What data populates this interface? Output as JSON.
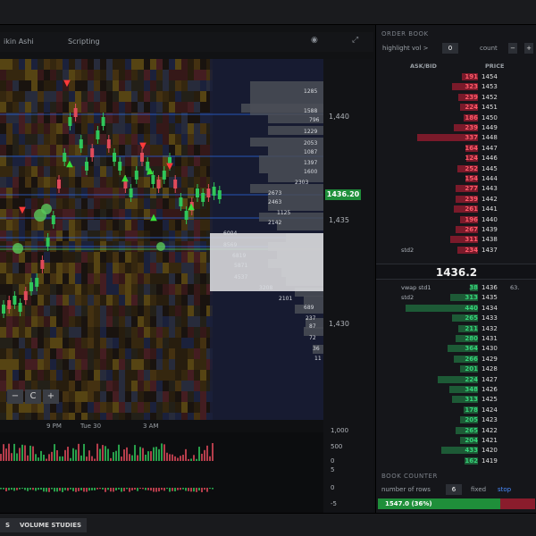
{
  "chart_header": {
    "tabs": [
      "ikin Ashi",
      "Scripting"
    ],
    "icons": [
      "camera-icon",
      "expand-icon"
    ]
  },
  "price_axis": {
    "ticks": [
      "1,440",
      "1,435",
      "1,430"
    ],
    "current_price": "1436.20"
  },
  "volume_labels": [
    {
      "text": "1285"
    },
    {
      "text": "1588"
    },
    {
      "text": "796"
    },
    {
      "text": "1229"
    },
    {
      "text": "2053"
    },
    {
      "text": "1087"
    },
    {
      "text": "1397"
    },
    {
      "text": "1600"
    },
    {
      "text": "2303"
    },
    {
      "text": "2673"
    },
    {
      "text": "2463"
    },
    {
      "text": "1125"
    },
    {
      "text": "2142"
    },
    {
      "text": "6004"
    },
    {
      "text": "8569"
    },
    {
      "text": "6819"
    },
    {
      "text": "5871"
    },
    {
      "text": "4537"
    },
    {
      "text": "3208"
    },
    {
      "text": "2101"
    },
    {
      "text": "689"
    },
    {
      "text": "237"
    },
    {
      "text": "87"
    },
    {
      "text": "72"
    },
    {
      "text": "36"
    },
    {
      "text": "11"
    }
  ],
  "zoom_controls": {
    "minus": "−",
    "reset": "C",
    "plus": "+"
  },
  "time_axis": [
    "9 PM",
    "Tue 30",
    "3 AM"
  ],
  "lower_axis": [
    "1,000",
    "500",
    "0",
    "5",
    "0",
    "-5"
  ],
  "bottom_bar": {
    "buttons": [
      "S",
      "VOLUME STUDIES"
    ]
  },
  "order_book": {
    "title": "ORDER BOOK",
    "highlight_label": "highlight vol >",
    "highlight_value": "0",
    "count_label": "count",
    "controls": [
      "−",
      "+"
    ],
    "columns": {
      "ask_bid": "ASK/BID",
      "price": "PRICE"
    },
    "asks": [
      {
        "qty": "191",
        "price": "1454",
        "w": 0.2
      },
      {
        "qty": "323",
        "price": "1453",
        "w": 0.32
      },
      {
        "qty": "239",
        "price": "1452",
        "w": 0.24
      },
      {
        "qty": "224",
        "price": "1451",
        "w": 0.22
      },
      {
        "qty": "186",
        "price": "1450",
        "w": 0.18
      },
      {
        "qty": "239",
        "price": "1449",
        "w": 0.3
      },
      {
        "qty": "337",
        "price": "1448",
        "w": 0.75
      },
      {
        "qty": "164",
        "price": "1447",
        "w": 0.16
      },
      {
        "qty": "124",
        "price": "1446",
        "w": 0.14
      },
      {
        "qty": "252",
        "price": "1445",
        "w": 0.26
      },
      {
        "qty": "154",
        "price": "1444",
        "w": 0.16
      },
      {
        "qty": "277",
        "price": "1443",
        "w": 0.28
      },
      {
        "qty": "239",
        "price": "1442",
        "w": 0.28
      },
      {
        "qty": "261",
        "price": "1441",
        "w": 0.3
      },
      {
        "qty": "196",
        "price": "1440",
        "w": 0.22
      },
      {
        "qty": "267",
        "price": "1439",
        "w": 0.28
      },
      {
        "qty": "311",
        "price": "1438",
        "w": 0.34
      },
      {
        "qty": "234",
        "price": "1437",
        "w": 0.26
      }
    ],
    "ask_labels": {
      "row17": "std2"
    },
    "mid_price": "1436.2",
    "bids": [
      {
        "qty": "38",
        "price": "1436",
        "w": 0.1
      },
      {
        "qty": "313",
        "price": "1435",
        "w": 0.34
      },
      {
        "qty": "440",
        "price": "1434",
        "w": 0.9
      },
      {
        "qty": "265",
        "price": "1433",
        "w": 0.32
      },
      {
        "qty": "211",
        "price": "1432",
        "w": 0.24
      },
      {
        "qty": "280",
        "price": "1431",
        "w": 0.28
      },
      {
        "qty": "364",
        "price": "1430",
        "w": 0.38
      },
      {
        "qty": "266",
        "price": "1429",
        "w": 0.3
      },
      {
        "qty": "201",
        "price": "1428",
        "w": 0.22
      },
      {
        "qty": "224",
        "price": "1427",
        "w": 0.5
      },
      {
        "qty": "348",
        "price": "1426",
        "w": 0.36
      },
      {
        "qty": "313",
        "price": "1425",
        "w": 0.32
      },
      {
        "qty": "178",
        "price": "1424",
        "w": 0.18
      },
      {
        "qty": "205",
        "price": "1423",
        "w": 0.22
      },
      {
        "qty": "265",
        "price": "1422",
        "w": 0.28
      },
      {
        "qty": "204",
        "price": "1421",
        "w": 0.22
      },
      {
        "qty": "433",
        "price": "1420",
        "w": 0.45
      },
      {
        "qty": "162",
        "price": "1419",
        "w": 0.17
      }
    ],
    "bid_labels": {
      "row0": "vwap std1",
      "row1": "std2",
      "row0_extra": "63."
    }
  },
  "book_counter": {
    "title": "BOOK COUNTER",
    "rows_label": "number of rows",
    "rows_value": "6",
    "fixed_label": "fixed",
    "stop_label": "stop",
    "bar_value": "1547.0",
    "bar_unit": "(36%)",
    "bar_fraction": 0.78
  },
  "colors": {
    "ask_bar": "#7a1a2a",
    "ask_text": "#ff5a6a",
    "bid_bar": "#1d5a36",
    "bid_text": "#36d47a",
    "accent": "#2a64d8",
    "price_tag": "#1f8f3a"
  }
}
